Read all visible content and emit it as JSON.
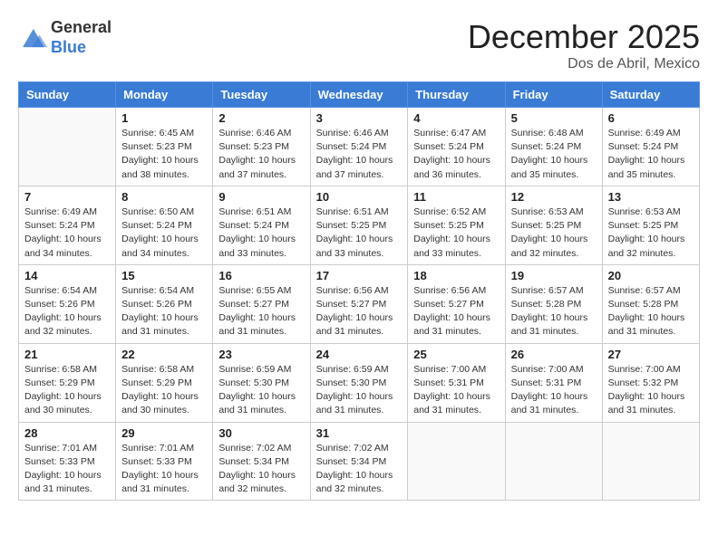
{
  "header": {
    "logo": {
      "general": "General",
      "blue": "Blue"
    },
    "title": "December 2025",
    "location": "Dos de Abril, Mexico"
  },
  "days_of_week": [
    "Sunday",
    "Monday",
    "Tuesday",
    "Wednesday",
    "Thursday",
    "Friday",
    "Saturday"
  ],
  "weeks": [
    [
      {
        "day": "",
        "info": ""
      },
      {
        "day": "1",
        "info": "Sunrise: 6:45 AM\nSunset: 5:23 PM\nDaylight: 10 hours\nand 38 minutes."
      },
      {
        "day": "2",
        "info": "Sunrise: 6:46 AM\nSunset: 5:23 PM\nDaylight: 10 hours\nand 37 minutes."
      },
      {
        "day": "3",
        "info": "Sunrise: 6:46 AM\nSunset: 5:24 PM\nDaylight: 10 hours\nand 37 minutes."
      },
      {
        "day": "4",
        "info": "Sunrise: 6:47 AM\nSunset: 5:24 PM\nDaylight: 10 hours\nand 36 minutes."
      },
      {
        "day": "5",
        "info": "Sunrise: 6:48 AM\nSunset: 5:24 PM\nDaylight: 10 hours\nand 35 minutes."
      },
      {
        "day": "6",
        "info": "Sunrise: 6:49 AM\nSunset: 5:24 PM\nDaylight: 10 hours\nand 35 minutes."
      }
    ],
    [
      {
        "day": "7",
        "info": "Sunrise: 6:49 AM\nSunset: 5:24 PM\nDaylight: 10 hours\nand 34 minutes."
      },
      {
        "day": "8",
        "info": "Sunrise: 6:50 AM\nSunset: 5:24 PM\nDaylight: 10 hours\nand 34 minutes."
      },
      {
        "day": "9",
        "info": "Sunrise: 6:51 AM\nSunset: 5:24 PM\nDaylight: 10 hours\nand 33 minutes."
      },
      {
        "day": "10",
        "info": "Sunrise: 6:51 AM\nSunset: 5:25 PM\nDaylight: 10 hours\nand 33 minutes."
      },
      {
        "day": "11",
        "info": "Sunrise: 6:52 AM\nSunset: 5:25 PM\nDaylight: 10 hours\nand 33 minutes."
      },
      {
        "day": "12",
        "info": "Sunrise: 6:53 AM\nSunset: 5:25 PM\nDaylight: 10 hours\nand 32 minutes."
      },
      {
        "day": "13",
        "info": "Sunrise: 6:53 AM\nSunset: 5:25 PM\nDaylight: 10 hours\nand 32 minutes."
      }
    ],
    [
      {
        "day": "14",
        "info": "Sunrise: 6:54 AM\nSunset: 5:26 PM\nDaylight: 10 hours\nand 32 minutes."
      },
      {
        "day": "15",
        "info": "Sunrise: 6:54 AM\nSunset: 5:26 PM\nDaylight: 10 hours\nand 31 minutes."
      },
      {
        "day": "16",
        "info": "Sunrise: 6:55 AM\nSunset: 5:27 PM\nDaylight: 10 hours\nand 31 minutes."
      },
      {
        "day": "17",
        "info": "Sunrise: 6:56 AM\nSunset: 5:27 PM\nDaylight: 10 hours\nand 31 minutes."
      },
      {
        "day": "18",
        "info": "Sunrise: 6:56 AM\nSunset: 5:27 PM\nDaylight: 10 hours\nand 31 minutes."
      },
      {
        "day": "19",
        "info": "Sunrise: 6:57 AM\nSunset: 5:28 PM\nDaylight: 10 hours\nand 31 minutes."
      },
      {
        "day": "20",
        "info": "Sunrise: 6:57 AM\nSunset: 5:28 PM\nDaylight: 10 hours\nand 31 minutes."
      }
    ],
    [
      {
        "day": "21",
        "info": "Sunrise: 6:58 AM\nSunset: 5:29 PM\nDaylight: 10 hours\nand 30 minutes."
      },
      {
        "day": "22",
        "info": "Sunrise: 6:58 AM\nSunset: 5:29 PM\nDaylight: 10 hours\nand 30 minutes."
      },
      {
        "day": "23",
        "info": "Sunrise: 6:59 AM\nSunset: 5:30 PM\nDaylight: 10 hours\nand 31 minutes."
      },
      {
        "day": "24",
        "info": "Sunrise: 6:59 AM\nSunset: 5:30 PM\nDaylight: 10 hours\nand 31 minutes."
      },
      {
        "day": "25",
        "info": "Sunrise: 7:00 AM\nSunset: 5:31 PM\nDaylight: 10 hours\nand 31 minutes."
      },
      {
        "day": "26",
        "info": "Sunrise: 7:00 AM\nSunset: 5:31 PM\nDaylight: 10 hours\nand 31 minutes."
      },
      {
        "day": "27",
        "info": "Sunrise: 7:00 AM\nSunset: 5:32 PM\nDaylight: 10 hours\nand 31 minutes."
      }
    ],
    [
      {
        "day": "28",
        "info": "Sunrise: 7:01 AM\nSunset: 5:33 PM\nDaylight: 10 hours\nand 31 minutes."
      },
      {
        "day": "29",
        "info": "Sunrise: 7:01 AM\nSunset: 5:33 PM\nDaylight: 10 hours\nand 31 minutes."
      },
      {
        "day": "30",
        "info": "Sunrise: 7:02 AM\nSunset: 5:34 PM\nDaylight: 10 hours\nand 32 minutes."
      },
      {
        "day": "31",
        "info": "Sunrise: 7:02 AM\nSunset: 5:34 PM\nDaylight: 10 hours\nand 32 minutes."
      },
      {
        "day": "",
        "info": ""
      },
      {
        "day": "",
        "info": ""
      },
      {
        "day": "",
        "info": ""
      }
    ]
  ]
}
